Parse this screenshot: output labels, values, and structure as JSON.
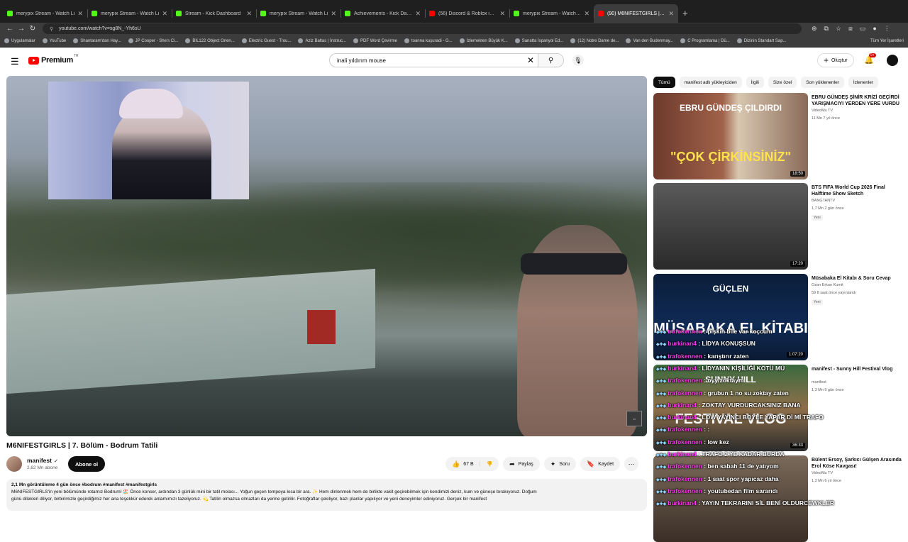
{
  "browser": {
    "tabs": [
      {
        "title": "merypix Stream - Watch Li",
        "favicon_color": "#53fc18",
        "active": false
      },
      {
        "title": "merypix Stream - Watch Li",
        "favicon_color": "#53fc18",
        "active": false
      },
      {
        "title": "Stream - Kick Dashboard",
        "favicon_color": "#53fc18",
        "active": false
      },
      {
        "title": "merypix Stream - Watch Li",
        "favicon_color": "#53fc18",
        "active": false
      },
      {
        "title": "Achievements - Kick Dashb",
        "favicon_color": "#53fc18",
        "active": false
      },
      {
        "title": "(56) Discord & Roblox iPhone",
        "favicon_color": "#ff0000",
        "active": false
      },
      {
        "title": "merypix Stream - Watch Live",
        "favicon_color": "#53fc18",
        "active": false
      },
      {
        "title": "(90) M6NIFESTGIRLS | 7. Bölüm",
        "favicon_color": "#ff0000",
        "active": true
      }
    ],
    "new_tab": "+",
    "url": "youtube.com/watch?v=sg8N_-Yh6sU",
    "bookmarks": [
      {
        "label": "Uygulamalar"
      },
      {
        "label": "YouTube"
      },
      {
        "label": "Shantaram'dan Hay..."
      },
      {
        "label": "JP Cooper - She's Ci..."
      },
      {
        "label": "BIL122 Object Orien..."
      },
      {
        "label": "Electric Guest - Trou..."
      },
      {
        "label": "Aziz Baltas | İnstruc..."
      },
      {
        "label": "PDF Word Çevirme"
      },
      {
        "label": "toanna kuşuradi - G..."
      },
      {
        "label": "İzlemekten Büyük K..."
      },
      {
        "label": "Sanatta İspanyol Ed..."
      },
      {
        "label": "(12) Notre Dame de..."
      },
      {
        "label": "Van den Budenmay..."
      },
      {
        "label": "C Programlama | Dü..."
      },
      {
        "label": "Dizinin Standart Sap..."
      }
    ],
    "bookmarks_right": "Tüm Yer İşaretleri"
  },
  "yt": {
    "logo": "Premium",
    "logo_sup": "TR",
    "search_query": "inali yıldırım mouse",
    "create_label": "Oluştur",
    "bell_badge": "9+"
  },
  "video": {
    "title": "M6NIFESTGIRLS | 7. Bölüm - Bodrum Tatili",
    "channel": "manifest",
    "subscribers": "2,62 Mn abone",
    "subscribe_label": "Abone ol",
    "likes": "67 B",
    "share_label": "Paylaş",
    "ask_label": "Soru",
    "save_label": "Kaydet",
    "desc_meta": "2,1 Mn görüntüleme  4 gün önce  #bodrum #manifest #manifestgirls",
    "desc_line1": "M6NIFESTGIRLS'in yeni bölümünde rotamız Bodrum! 🏖️ Önce konser, ardından 3 günlük mini bir tatil molası... Yoğun geçen tempoya kısa bir ara. ✨ Hem dinlenmek hem de birlikte vakit geçirebilmek için kendimizi deniz, kum ve güneşe bırakıyoruz. Doğum",
    "desc_line2": "günü dilekleri diliyor, birbirimizle geçirdiğimiz her ana teşekkür ederek anlamımızı tazeliyoruz. 💫  Tatilin olmazsa olmazları da yerine getirilir. Fotoğraflar çekiliyor, bazı planlar yapılıyor ve yeni deneyimler ediniyoruz. Gerçek bir manifest"
  },
  "chips": [
    "Tümü",
    "manifest adlı yükleyiciden",
    "İlgili",
    "Size özel",
    "Son yüklenenler",
    "İzlenenler"
  ],
  "related": [
    {
      "title": "EBRU GÜNDEŞ ŞİNİR KRİZİ GEÇİRDİ YARIŞMACIYI YERDEN YERE VURDU",
      "channel": "VideoMu TV",
      "meta": "11 Mn  7 yıl önce",
      "duration": "18:50",
      "badge": "",
      "thumb_text_top": "EBRU GÜNDEŞ ÇILDIRDI",
      "thumb_text_bottom": "\"ÇOK ÇİRKİNSİNİZ\""
    },
    {
      "title": "BTS FIFA World Cup 2026 Final Halftime Show Sketch",
      "channel": "BANGTANTV",
      "meta": "1,7 Mn  2 gün önce",
      "duration": "17:20",
      "badge": "Yeni",
      "thumb_text_top": "",
      "thumb_text_bottom": ""
    },
    {
      "title": "Müsabaka El Kitabı & Soru Cevap",
      "channel": "Ozan Erkan Kumit",
      "meta": "59  8 saat önce yayınlandı",
      "duration": "1:07:20",
      "badge": "Yeni",
      "thumb_text_top": "GÜÇLEN",
      "thumb_text_bottom": "MÜSABAKA EL KİTABI"
    },
    {
      "title": "manifest - Sunny Hill Festival Vlog",
      "channel": "manifest",
      "meta": "1,3 Mn  9 gün önce",
      "duration": "36:33",
      "badge": "",
      "thumb_text_top": "SUNNY HILL",
      "thumb_text_bottom": "FESTIVAL VLOG"
    },
    {
      "title": "Bülent Ersoy, Şarkıcı Gülşen Arasında Erol Köse Kavgası!",
      "channel": "VideoMu TV",
      "meta": "1,2 Mn  6 yıl önce",
      "duration": "",
      "badge": "",
      "thumb_text_top": "",
      "thumb_text_bottom": ""
    }
  ],
  "chat": [
    {
      "user": "trafokennen",
      "text": "pişkin bile var koçcum"
    },
    {
      "user": "burkinan4",
      "text": "LİDYA KONUŞSUN"
    },
    {
      "user": "trafokennen",
      "text": "karıştırır zaten"
    },
    {
      "user": "burkinan4",
      "text": "LİDYANIN KİŞİLİĞİ KÖTÜ MÜ"
    },
    {
      "user": "trafokennen",
      "text": "oyy zoktaym"
    },
    {
      "user": "trafokennen",
      "text": "grubun 1 no su zoktay zaten"
    },
    {
      "user": "burkinan4",
      "text": "ZOKTAY VURDURCAKSINIZ BANA"
    },
    {
      "user": "burkinan4",
      "text": "LOW YAYINCI BÖYLE YAPAR Dİ Mİ TRAFO"
    },
    {
      "user": "trafokennen",
      "text": ":"
    },
    {
      "user": "trafokennen",
      "text": "low kez"
    },
    {
      "user": "burkinan4",
      "text": "TRAFO 2 YE KADAR BURDA"
    },
    {
      "user": "trafokennen",
      "text": "ben sabah 11 de yatıyom"
    },
    {
      "user": "trafokennen",
      "text": "1 saat spor yapıcaz daha"
    },
    {
      "user": "trafokennen",
      "text": "youtubedan film sararıdı"
    },
    {
      "user": "burkinan4",
      "text": "YAYIN TEKRARINI SİL BENİ OLDURCEWKLER"
    }
  ]
}
